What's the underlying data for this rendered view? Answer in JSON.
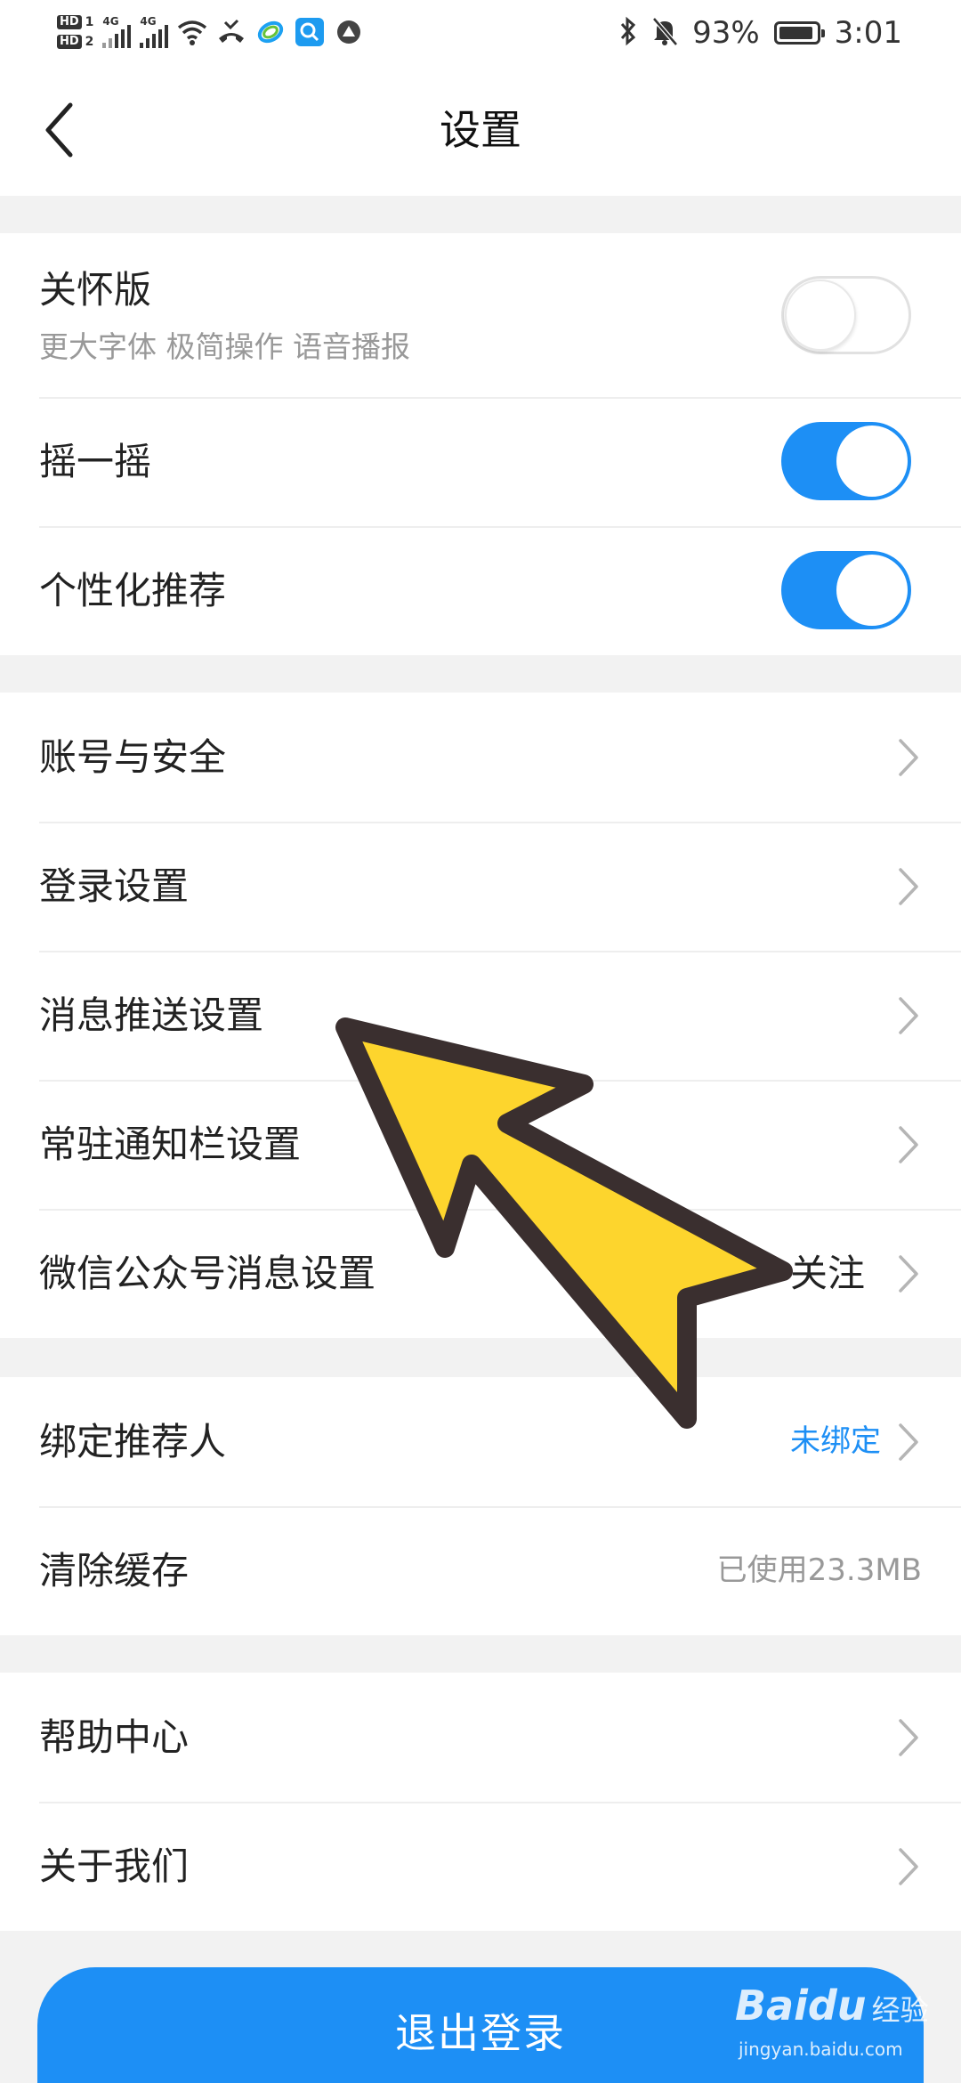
{
  "status_bar": {
    "hd1": "HD",
    "hd1_num": "1",
    "hd2": "HD",
    "hd2_num": "2",
    "net1": "4G",
    "net2": "4G",
    "battery": "93%",
    "battery_level": 0.93,
    "time": "3:01"
  },
  "header": {
    "title": "设置"
  },
  "care_mode": {
    "title": "关怀版",
    "subtitle": "更大字体 极简操作 语音播报",
    "enabled": false
  },
  "toggles": [
    {
      "label": "摇一摇",
      "enabled": true
    },
    {
      "label": "个性化推荐",
      "enabled": true
    }
  ],
  "settings_group": [
    {
      "label": "账号与安全"
    },
    {
      "label": "登录设置"
    },
    {
      "label": "消息推送设置"
    },
    {
      "label": "常驻通知栏设置"
    },
    {
      "label": "微信公众号消息设置",
      "value": "关注"
    }
  ],
  "referrer": {
    "label": "绑定推荐人",
    "value": "未绑定",
    "value_color": "#1d8ff5"
  },
  "cache": {
    "label": "清除缓存",
    "value": "已使用23.3MB",
    "value_color": "#999999"
  },
  "help_group": [
    {
      "label": "帮助中心"
    },
    {
      "label": "关于我们"
    }
  ],
  "logout": {
    "label": "退出登录"
  },
  "watermark": {
    "logo": "Bai",
    "logo_paw": "du",
    "cn": "经验",
    "url": "jingyan.baidu.com"
  },
  "colors": {
    "accent": "#1d8ff5",
    "arrow_fill": "#fdd52d",
    "arrow_outline": "#3a2f2f"
  }
}
